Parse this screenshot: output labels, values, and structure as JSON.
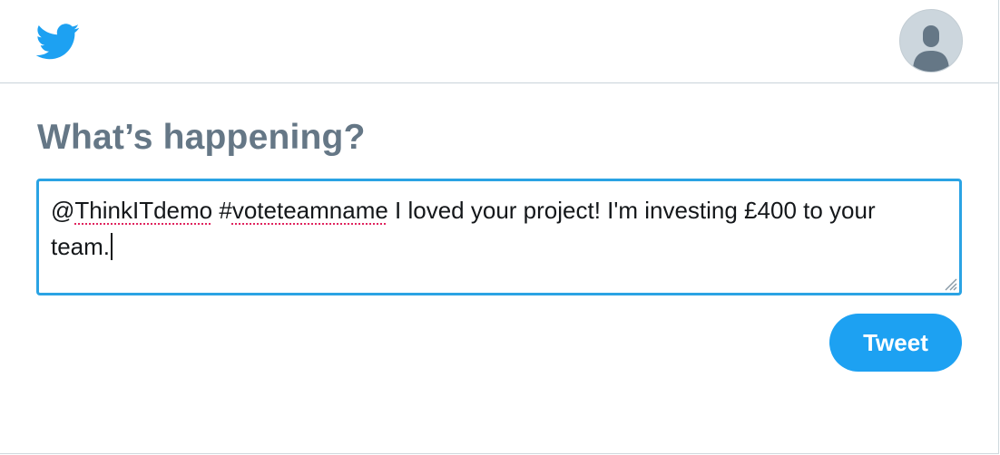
{
  "header": {
    "logo_icon": "twitter-bird-icon",
    "avatar_icon": "default-profile-avatar-icon",
    "brand_color": "#1da1f2"
  },
  "compose": {
    "heading": "What’s happening?",
    "text_segments": [
      {
        "text": "@",
        "spellcheck_flag": false
      },
      {
        "text": "ThinkITdemo",
        "spellcheck_flag": true
      },
      {
        "text": " #",
        "spellcheck_flag": false
      },
      {
        "text": "voteteamname",
        "spellcheck_flag": true
      },
      {
        "text": " I loved your project! I'm investing £400 to your team.",
        "spellcheck_flag": false
      }
    ],
    "focus_border_color": "#2aa3e4",
    "spellcheck_underline_color": "#e0245e"
  },
  "actions": {
    "tweet_label": "Tweet"
  },
  "colors": {
    "heading": "#657786",
    "divider": "#c8d3da"
  }
}
